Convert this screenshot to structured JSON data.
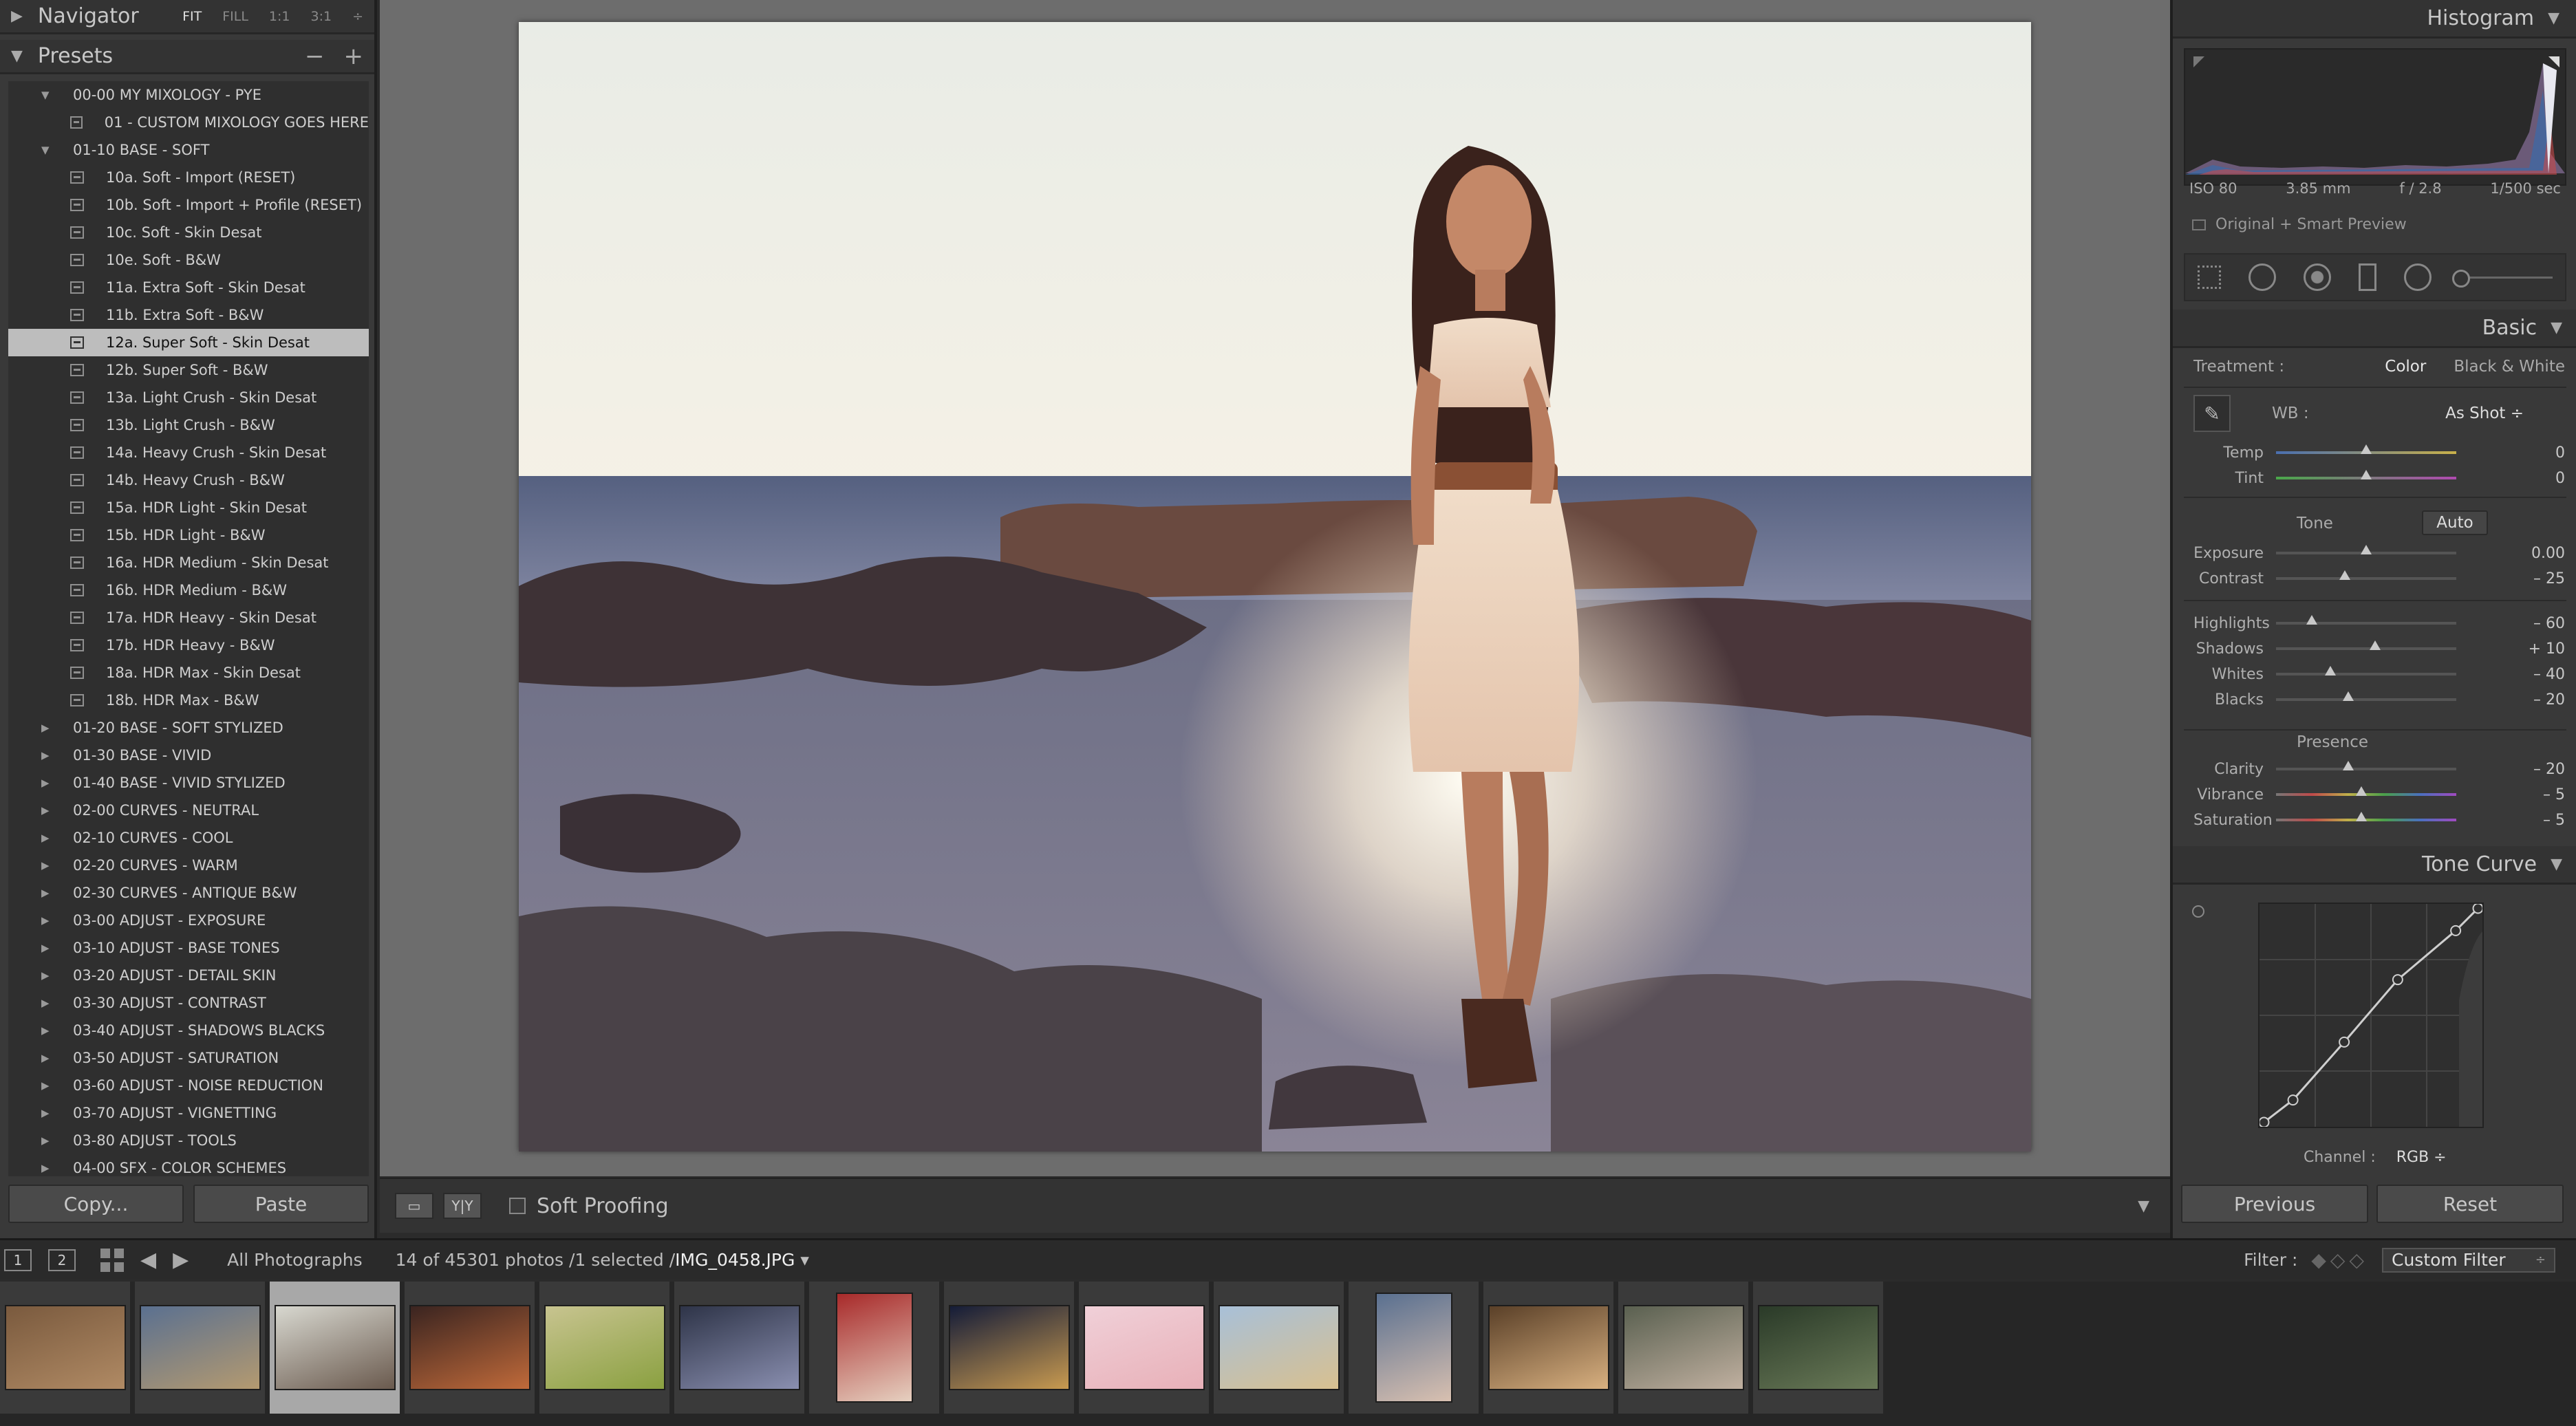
{
  "navigator": {
    "title": "Navigator",
    "options": [
      "FIT",
      "FILL",
      "1:1",
      "3:1"
    ],
    "active_option": "FIT",
    "more": "÷"
  },
  "presets": {
    "title": "Presets",
    "remove_label": "−",
    "add_label": "+",
    "rows": [
      {
        "type": "folder",
        "open": true,
        "label": "00-00 MY MIXOLOGY - PYE"
      },
      {
        "type": "preset",
        "label": "01 - CUSTOM MIXOLOGY GOES HERE"
      },
      {
        "type": "folder",
        "open": true,
        "label": "01-10 BASE - SOFT"
      },
      {
        "type": "preset",
        "label": "10a. Soft - Import (RESET)"
      },
      {
        "type": "preset",
        "label": "10b. Soft - Import + Profile (RESET)"
      },
      {
        "type": "preset",
        "label": "10c. Soft - Skin Desat"
      },
      {
        "type": "preset",
        "label": "10e. Soft - B&W"
      },
      {
        "type": "preset",
        "label": "11a. Extra Soft - Skin Desat"
      },
      {
        "type": "preset",
        "label": "11b. Extra Soft - B&W"
      },
      {
        "type": "preset",
        "label": "12a. Super Soft - Skin Desat",
        "selected": true
      },
      {
        "type": "preset",
        "label": "12b. Super Soft - B&W"
      },
      {
        "type": "preset",
        "label": "13a. Light Crush - Skin Desat"
      },
      {
        "type": "preset",
        "label": "13b. Light Crush - B&W"
      },
      {
        "type": "preset",
        "label": "14a. Heavy Crush - Skin Desat"
      },
      {
        "type": "preset",
        "label": "14b. Heavy Crush - B&W"
      },
      {
        "type": "preset",
        "label": "15a. HDR Light - Skin Desat"
      },
      {
        "type": "preset",
        "label": "15b. HDR Light - B&W"
      },
      {
        "type": "preset",
        "label": "16a. HDR Medium - Skin Desat"
      },
      {
        "type": "preset",
        "label": "16b. HDR Medium - B&W"
      },
      {
        "type": "preset",
        "label": "17a. HDR Heavy - Skin Desat"
      },
      {
        "type": "preset",
        "label": "17b. HDR Heavy - B&W"
      },
      {
        "type": "preset",
        "label": "18a. HDR Max - Skin Desat"
      },
      {
        "type": "preset",
        "label": "18b. HDR Max - B&W"
      },
      {
        "type": "folder",
        "open": false,
        "label": "01-20 BASE - SOFT STYLIZED"
      },
      {
        "type": "folder",
        "open": false,
        "label": "01-30 BASE - VIVID"
      },
      {
        "type": "folder",
        "open": false,
        "label": "01-40 BASE - VIVID STYLIZED"
      },
      {
        "type": "folder",
        "open": false,
        "label": "02-00 CURVES - NEUTRAL"
      },
      {
        "type": "folder",
        "open": false,
        "label": "02-10 CURVES - COOL"
      },
      {
        "type": "folder",
        "open": false,
        "label": "02-20 CURVES - WARM"
      },
      {
        "type": "folder",
        "open": false,
        "label": "02-30 CURVES - ANTIQUE B&W"
      },
      {
        "type": "folder",
        "open": false,
        "label": "03-00 ADJUST - EXPOSURE"
      },
      {
        "type": "folder",
        "open": false,
        "label": "03-10 ADJUST - BASE TONES"
      },
      {
        "type": "folder",
        "open": false,
        "label": "03-20 ADJUST - DETAIL SKIN"
      },
      {
        "type": "folder",
        "open": false,
        "label": "03-30 ADJUST - CONTRAST"
      },
      {
        "type": "folder",
        "open": false,
        "label": "03-40 ADJUST - SHADOWS BLACKS"
      },
      {
        "type": "folder",
        "open": false,
        "label": "03-50 ADJUST - SATURATION"
      },
      {
        "type": "folder",
        "open": false,
        "label": "03-60 ADJUST - NOISE REDUCTION"
      },
      {
        "type": "folder",
        "open": false,
        "label": "03-70 ADJUST - VIGNETTING"
      },
      {
        "type": "folder",
        "open": false,
        "label": "03-80 ADJUST - TOOLS"
      },
      {
        "type": "folder",
        "open": false,
        "label": "04-00 SFX - COLOR SCHEMES"
      }
    ]
  },
  "left_buttons": {
    "copy": "Copy...",
    "paste": "Paste"
  },
  "toolbar": {
    "soft_proofing": "Soft Proofing",
    "compare_label": "Y|Y"
  },
  "histogram": {
    "title": "Histogram",
    "iso": "ISO 80",
    "focal": "3.85 mm",
    "aperture": "f / 2.8",
    "shutter": "1/500 sec",
    "preview": "Original + Smart Preview"
  },
  "basic": {
    "title": "Basic",
    "treatment_label": "Treatment :",
    "treatment_color": "Color",
    "treatment_bw": "Black & White",
    "wb_label": "WB :",
    "wb_value": "As Shot ÷",
    "tone_label": "Tone",
    "auto_label": "Auto",
    "presence_label": "Presence",
    "sliders": [
      {
        "key": "temp",
        "label": "Temp",
        "value": "0",
        "pos": 0.5,
        "track": "temp"
      },
      {
        "key": "tint",
        "label": "Tint",
        "value": "0",
        "pos": 0.5,
        "track": "tint"
      },
      {
        "key": "exposure",
        "label": "Exposure",
        "value": "0.00",
        "pos": 0.5,
        "track": ""
      },
      {
        "key": "contrast",
        "label": "Contrast",
        "value": "– 25",
        "pos": 0.38,
        "track": ""
      },
      {
        "key": "highlights",
        "label": "Highlights",
        "value": "– 60",
        "pos": 0.2,
        "track": ""
      },
      {
        "key": "shadows",
        "label": "Shadows",
        "value": "+ 10",
        "pos": 0.55,
        "track": ""
      },
      {
        "key": "whites",
        "label": "Whites",
        "value": "– 40",
        "pos": 0.3,
        "track": ""
      },
      {
        "key": "blacks",
        "label": "Blacks",
        "value": "– 20",
        "pos": 0.4,
        "track": ""
      },
      {
        "key": "clarity",
        "label": "Clarity",
        "value": "– 20",
        "pos": 0.4,
        "track": ""
      },
      {
        "key": "vibrance",
        "label": "Vibrance",
        "value": "– 5",
        "pos": 0.475,
        "track": "vib"
      },
      {
        "key": "saturation",
        "label": "Saturation",
        "value": "– 5",
        "pos": 0.475,
        "track": "sat"
      }
    ]
  },
  "tone_curve": {
    "title": "Tone Curve",
    "channel_label": "Channel :",
    "channel_value": "RGB ÷",
    "points": [
      [
        0.02,
        0.02
      ],
      [
        0.15,
        0.12
      ],
      [
        0.38,
        0.38
      ],
      [
        0.62,
        0.66
      ],
      [
        0.88,
        0.88
      ],
      [
        0.98,
        0.98
      ]
    ]
  },
  "right_buttons": {
    "previous": "Previous",
    "reset": "Reset"
  },
  "film_bar": {
    "screen1": "1",
    "screen2": "2",
    "source": "All Photographs",
    "count": "14 of 45301 photos /1 selected /",
    "filename": "IMG_0458.JPG",
    "filter_label": "Filter :",
    "filter_value": "Custom Filter",
    "filter_arrow": "÷"
  },
  "filmstrip": [
    {
      "colors": [
        "#7a5a3e",
        "#b08a64"
      ],
      "orient": "land"
    },
    {
      "colors": [
        "#5a7090",
        "#b49a70"
      ],
      "orient": "land"
    },
    {
      "colors": [
        "#d8d8d0",
        "#6a5a4e"
      ],
      "orient": "land",
      "selected": true
    },
    {
      "colors": [
        "#3a2420",
        "#c06a3a"
      ],
      "orient": "land"
    },
    {
      "colors": [
        "#c8c490",
        "#8aa040"
      ],
      "orient": "land"
    },
    {
      "colors": [
        "#2e3448",
        "#8a8fb0"
      ],
      "orient": "land"
    },
    {
      "colors": [
        "#a82a2a",
        "#e6d0c0"
      ],
      "orient": "port"
    },
    {
      "colors": [
        "#141c38",
        "#c89a50"
      ],
      "orient": "land"
    },
    {
      "colors": [
        "#f0d0d8",
        "#e8b0b8"
      ],
      "orient": "land"
    },
    {
      "colors": [
        "#a8c0d8",
        "#d8c090"
      ],
      "orient": "land"
    },
    {
      "colors": [
        "#5a7090",
        "#d8c0b0"
      ],
      "orient": "port"
    },
    {
      "colors": [
        "#5a4028",
        "#d8b080"
      ],
      "orient": "land"
    },
    {
      "colors": [
        "#5a6050",
        "#c0b0a0"
      ],
      "orient": "land"
    },
    {
      "colors": [
        "#2a3a28",
        "#6a7a58"
      ],
      "orient": "land"
    }
  ]
}
